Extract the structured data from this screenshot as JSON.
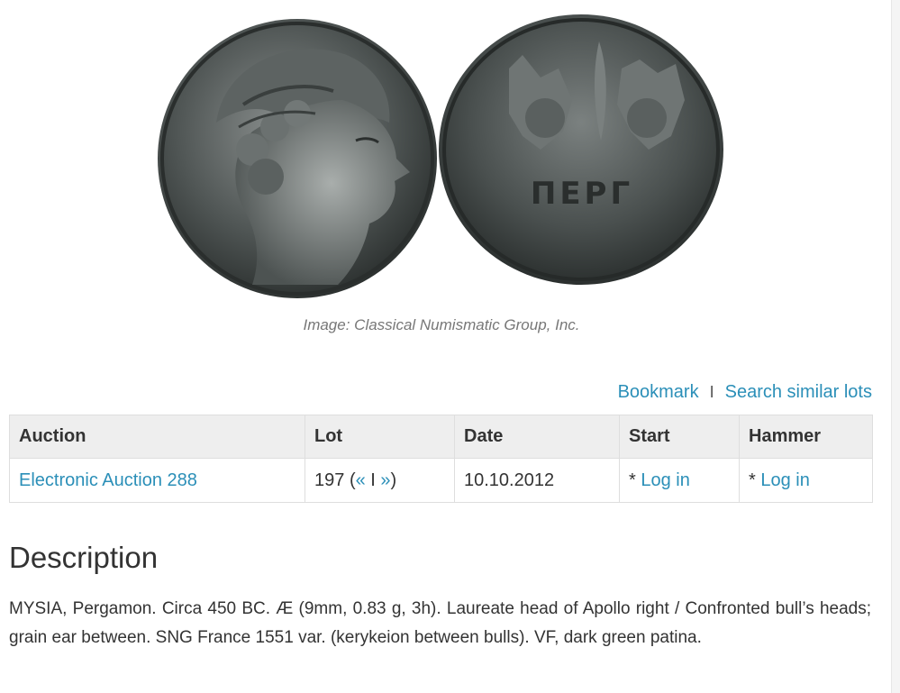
{
  "coin_image": {
    "reverse_legend": "ΠΕΡΓ"
  },
  "caption": "Image: Classical Numismatic Group, Inc.",
  "actions": {
    "bookmark_label": "Bookmark",
    "separator": "I",
    "search_similar_label": "Search similar lots"
  },
  "table": {
    "headers": [
      "Auction",
      "Lot",
      "Date",
      "Start",
      "Hammer"
    ],
    "row": {
      "auction": "Electronic Auction 288",
      "lot_number": "197",
      "lot_prev": "«",
      "lot_sep": "I",
      "lot_next": "»",
      "date": "10.10.2012",
      "start_prefix": "* ",
      "start_link": "Log in",
      "hammer_prefix": "* ",
      "hammer_link": "Log in"
    }
  },
  "description": {
    "heading": "Description",
    "text": "MYSIA, Pergamon. Circa 450 BC. Æ (9mm, 0.83 g, 3h). Laureate head of Apollo right / Confronted bull’s heads; grain ear between. SNG France 1551 var. (kerykeion between bulls). VF, dark green patina."
  },
  "colors": {
    "link": "#2b8fb8",
    "header_bg": "#eeeeee",
    "border": "#dedede",
    "caption": "#777777"
  }
}
